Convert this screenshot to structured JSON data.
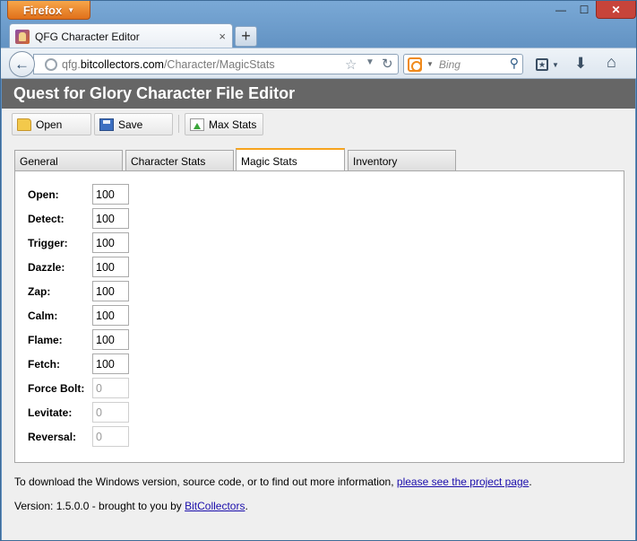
{
  "browser": {
    "menu_label": "Firefox",
    "window_min": "—",
    "window_max": "☐",
    "window_close": "✕",
    "tab_title": "QFG Character Editor",
    "tab_close": "×",
    "new_tab": "+",
    "url_prefix": "qfg.",
    "url_domain": "bitcollectors.com",
    "url_path": "/Character/MagicStats",
    "search_placeholder": "Bing"
  },
  "app": {
    "title": "Quest for Glory Character File Editor",
    "toolbar": {
      "open_label": "Open",
      "save_label": "Save",
      "maxstats_label": "Max Stats"
    },
    "tabs": [
      {
        "label": "General"
      },
      {
        "label": "Character Stats"
      },
      {
        "label": "Magic Stats"
      },
      {
        "label": "Inventory"
      }
    ],
    "stats": [
      {
        "label": "Open:",
        "value": "100"
      },
      {
        "label": "Detect:",
        "value": "100"
      },
      {
        "label": "Trigger:",
        "value": "100"
      },
      {
        "label": "Dazzle:",
        "value": "100"
      },
      {
        "label": "Zap:",
        "value": "100"
      },
      {
        "label": "Calm:",
        "value": "100"
      },
      {
        "label": "Flame:",
        "value": "100"
      },
      {
        "label": "Fetch:",
        "value": "100"
      },
      {
        "label": "Force Bolt:",
        "value": "0"
      },
      {
        "label": "Levitate:",
        "value": "0"
      },
      {
        "label": "Reversal:",
        "value": "0"
      }
    ],
    "footer": {
      "download_text": "To download the Windows version, source code, or to find out more information, ",
      "project_link": "please see the project page",
      "download_end": ".",
      "version_text": "Version: 1.5.0.0 - brought to you by ",
      "bitcollectors_link": "BitCollectors",
      "version_end": "."
    }
  }
}
